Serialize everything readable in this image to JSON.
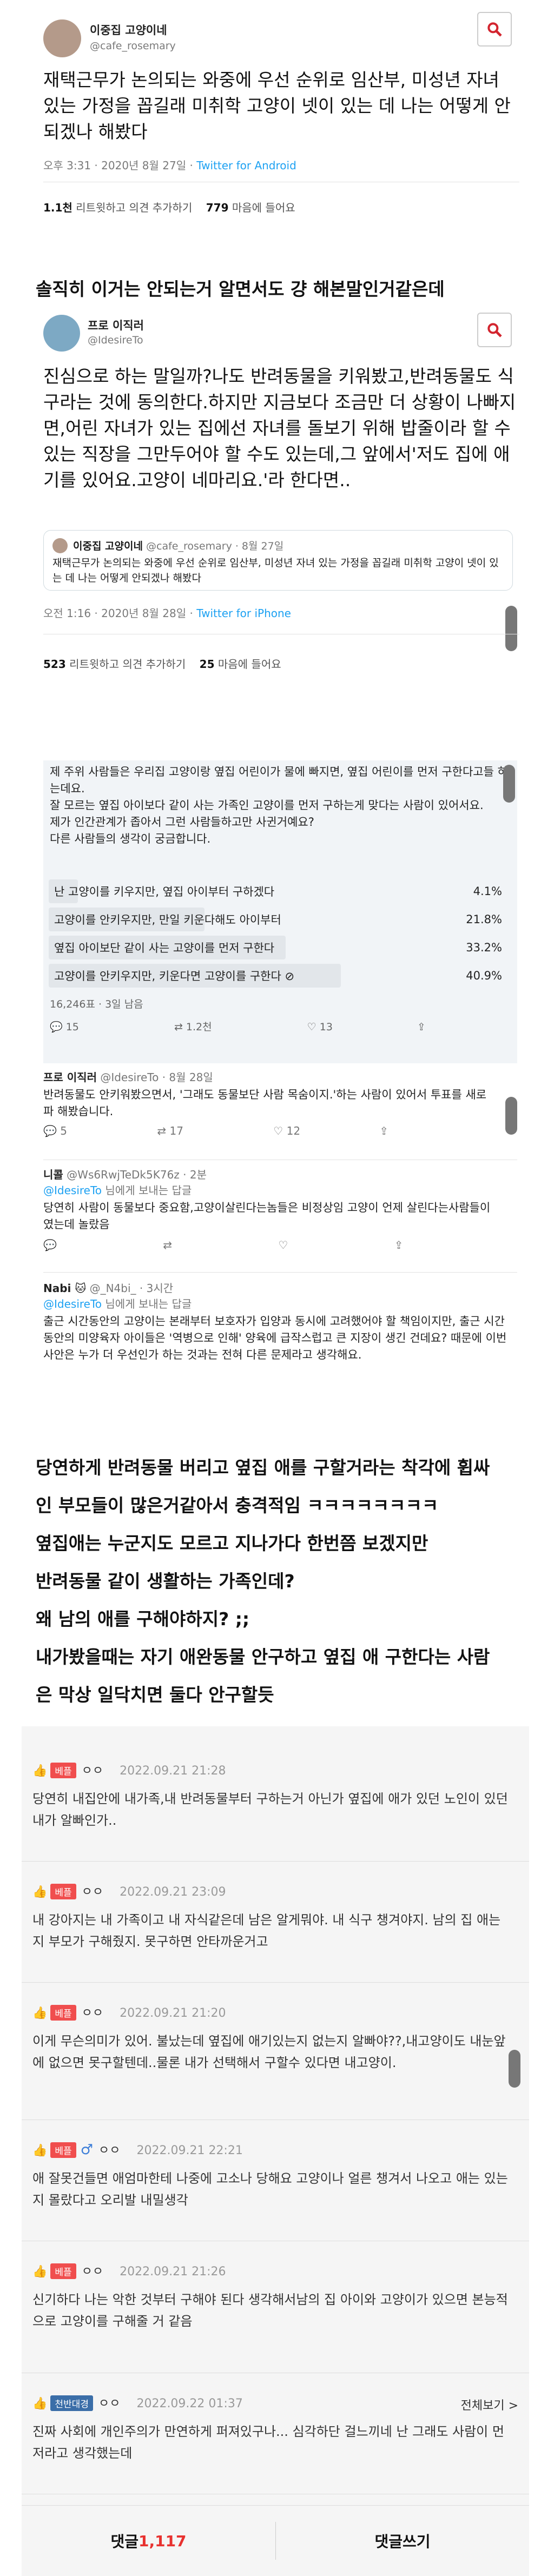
{
  "tweet1": {
    "name": "이중집 고양이네",
    "handle": "@cafe_rosemary",
    "body": "재택근무가 논의되는 와중에 우선 순위로 임산부, 미성년 자녀 있는 가정을 꼽길래 미취학 고양이 넷이 있는 데 나는 어떻게 안되겠나 해봤다",
    "meta_time": "오후 3:31 · 2020년 8월 27일 · ",
    "meta_src": "Twitter for Android",
    "retweets": "1.1천",
    "retweets_label": " 리트윗하고 의견 추가하기",
    "likes": "779",
    "likes_label": " 마음에 들어요"
  },
  "caption1": "솔직히 이거는 안되는거 알면서도 걍 해본말인거같은데",
  "tweet2": {
    "name": "프로 이직러",
    "handle": "@IdesireTo",
    "body": "진심으로 하는 말일까?나도 반려동물을 키워봤고,반려동물도 식구라는 것에 동의한다.하지만 지금보다 조금만 더 상황이 나빠지면,어린 자녀가 있는 집에선 자녀를 돌보기 위해 밥줄이라 할 수 있는 직장을 그만두어야 할 수도 있는데,그 앞에서'저도 집에 애기를 있어요.고양이 네마리요.'라 한다면..",
    "quote_name": "이중집 고양이네",
    "quote_handle": "@cafe_rosemary · 8월 27일",
    "quote_body": "재택근무가 논의되는 와중에 우선 순위로 임산부, 미성년 자녀 있는 가정을 꼽길래 미취학 고양이 넷이 있는 데 나는 어떻게 안되겠나 해봤다",
    "meta_time": "오전 1:16 · 2020년 8월 28일 · ",
    "meta_src": "Twitter for iPhone",
    "retweets": "523",
    "retweets_label": " 리트윗하고 의견 추가하기",
    "likes": "25",
    "likes_label": " 마음에 들어요"
  },
  "poll": {
    "question": "제 주위 사람들은 우리집 고양이랑 옆집 어린이가 물에 빠지면, 옆집 어린이를 먼저 구한다고들 하는데요.\n잘 모르는 옆집 아이보다 같이 사는 가족인 고양이를 먼저 구하는게 맞다는 사람이 있어서요.\n제가 인간관계가 좁아서 그런 사람들하고만 사귄거예요?\n다른 사람들의 생각이 궁금합니다.",
    "options": [
      {
        "label": "난 고양이를 키우지만, 옆집 아이부터 구하겠다",
        "pct": "4.1%",
        "value": 4.1
      },
      {
        "label": "고양이를 안키우지만, 만일 키운다해도 아이부터",
        "pct": "21.8%",
        "value": 21.8
      },
      {
        "label": "옆집 아이보단 같이 사는 고양이를 먼저 구한다",
        "pct": "33.2%",
        "value": 33.2
      },
      {
        "label": "고양이를 안키우지만, 키운다면 고양이를 구한다 ⊘",
        "pct": "40.9%",
        "value": 40.9
      }
    ],
    "votes": "16,246표 · 3일 남음",
    "replies": "15",
    "retweets": "1.2천",
    "likes": "13"
  },
  "reply1": {
    "name": "프로 이직러",
    "handle": "@IdesireTo · 8월 28일",
    "body": "반려동물도 안키워봤으면서, '그래도 동물보단 사람 목숨이지.'하는 사람이 있어서 투표를 새로파 해봤습니다.",
    "replies": "5",
    "retweets": "17",
    "likes": "12"
  },
  "reply2": {
    "name": "니콜",
    "handle": "@Ws6RwjTeDk5K76z · 2분",
    "to_prefix": "@IdesireTo",
    "to_suffix": " 님에게 보내는 답글",
    "body": "당연히 사람이 동물보다 중요함,고양이살린다는놈들은 비정상임 고양이 언제 살린다는사람들이였는데 놀랐음"
  },
  "reply3": {
    "name": "Nabi 🐱",
    "handle": "@_N4bi_ · 3시간",
    "to_prefix": "@IdesireTo",
    "to_suffix": " 님에게 보내는 답글",
    "body": "출근 시간동안의 고양이는 본래부터 보호자가 입양과 동시에 고려했어야 할 책임이지만, 출근 시간동안의 미양육자 아이들은 '역병으로 인해' 양육에 급작스럽고 큰 지장이 생긴 건데요? 때문에 이번 사안은 누가 더 우선인가 하는 것과는 전혀 다른 문제라고 생각해요."
  },
  "commentary": [
    "당연하게 반려동물 버리고 옆집 애를 구할거라는 착각에 휩싸",
    "인 부모들이 많은거같아서 충격적임 ㅋㅋㅋㅋㅋㅋㅋㅋ",
    "옆집애는 누군지도 모르고 지나가다 한번쯤 보겠지만",
    "반려동물 같이 생활하는 가족인데?",
    "왜 남의 애를 구해야하지? ;;",
    "내가봤을때는 자기 애완동물 안구하고 옆집 애 구한다는 사람",
    "은 막상 일닥치면 둘다 안구할듯"
  ],
  "comments": [
    {
      "badge": "베플",
      "user": "ㅇㅇ",
      "date": "2022.09.21 21:28",
      "text": "당연히 내집안에 내가족,내 반려동물부터 구하는거 아닌가 옆집에 애가 있던 노인이 있던 내가 알빠인가.."
    },
    {
      "badge": "베플",
      "user": "ㅇㅇ",
      "date": "2022.09.21 23:09",
      "text": "내 강아지는 내 가족이고 내 자식같은데 남은 알게뭐야. 내 식구 챙겨야지. 남의 집 애는 지 부모가 구해줬지. 못구하면 안타까운거고"
    },
    {
      "badge": "베플",
      "user": "ㅇㅇ",
      "date": "2022.09.21 21:20",
      "text": "이게 무슨의미가 있어. 불났는데 옆집에 애기있는지 없는지 알빠야??,내고양이도 내눈앞에 없으면 못구할텐데..물론 내가 선택해서 구할수 있다면 내고양이."
    },
    {
      "badge": "베플",
      "user": "ㅇㅇ",
      "gender": "♂",
      "date": "2022.09.21 22:21",
      "text": "애 잘못건들면 애엄마한테 나중에 고소나 당해요 고양이나 얼른 챙겨서 나오고 애는 있는지 몰랐다고 오리발 내밀생각"
    },
    {
      "badge": "베플",
      "user": "ㅇㅇ",
      "date": "2022.09.21 21:26",
      "text": "신기하다 나는 악한 것부터 구해야 된다 생각해서남의 집 아이와 고양이가 있으면 본능적으로 고양이를 구해줄 거 같음"
    },
    {
      "badge": "천반대경",
      "user": "ㅇㅇ",
      "date": "2022.09.22 01:37",
      "link": "전체보기 >",
      "text": "진짜 사회에 개인주의가 만연하게 퍼져있구나... 심각하단 걸느끼네 난 그래도 사람이 먼저라고 생각했는데"
    }
  ],
  "footer": {
    "comments_label": "댓글 ",
    "comments_count": "1,117",
    "write_label": "댓글쓰기"
  },
  "colors": {
    "accent": "#e8312f",
    "link": "#1da1f2",
    "badge": "#f04e4e"
  }
}
